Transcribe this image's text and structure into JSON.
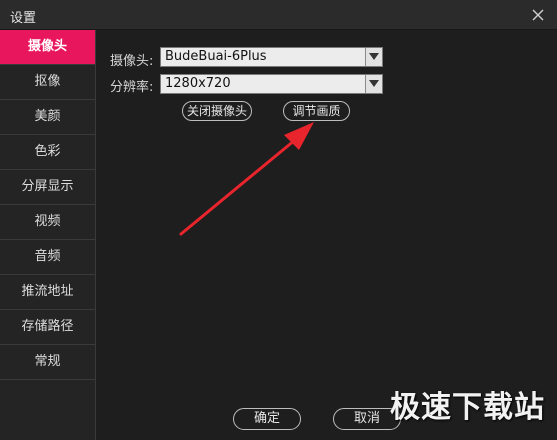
{
  "window": {
    "title": "设置"
  },
  "sidebar": {
    "items": [
      {
        "label": "摄像头",
        "active": true
      },
      {
        "label": "抠像",
        "active": false
      },
      {
        "label": "美颜",
        "active": false
      },
      {
        "label": "色彩",
        "active": false
      },
      {
        "label": "分屏显示",
        "active": false
      },
      {
        "label": "视频",
        "active": false
      },
      {
        "label": "音频",
        "active": false
      },
      {
        "label": "推流地址",
        "active": false
      },
      {
        "label": "存储路径",
        "active": false
      },
      {
        "label": "常规",
        "active": false
      }
    ]
  },
  "camera": {
    "camera_label": "摄像头:",
    "camera_value": "BudeBuai-6Plus",
    "resolution_label": "分辨率:",
    "resolution_value": "1280x720",
    "close_camera_button": "关闭摄像头",
    "adjust_quality_button": "调节画质"
  },
  "footer": {
    "ok_button": "确定",
    "cancel_button": "取消"
  },
  "watermark": "极速下载站",
  "colors": {
    "accent": "#e8175d",
    "annotation_arrow": "#e8242c"
  },
  "icons": {
    "close": "close-icon",
    "dropdown": "chevron-down-icon"
  }
}
